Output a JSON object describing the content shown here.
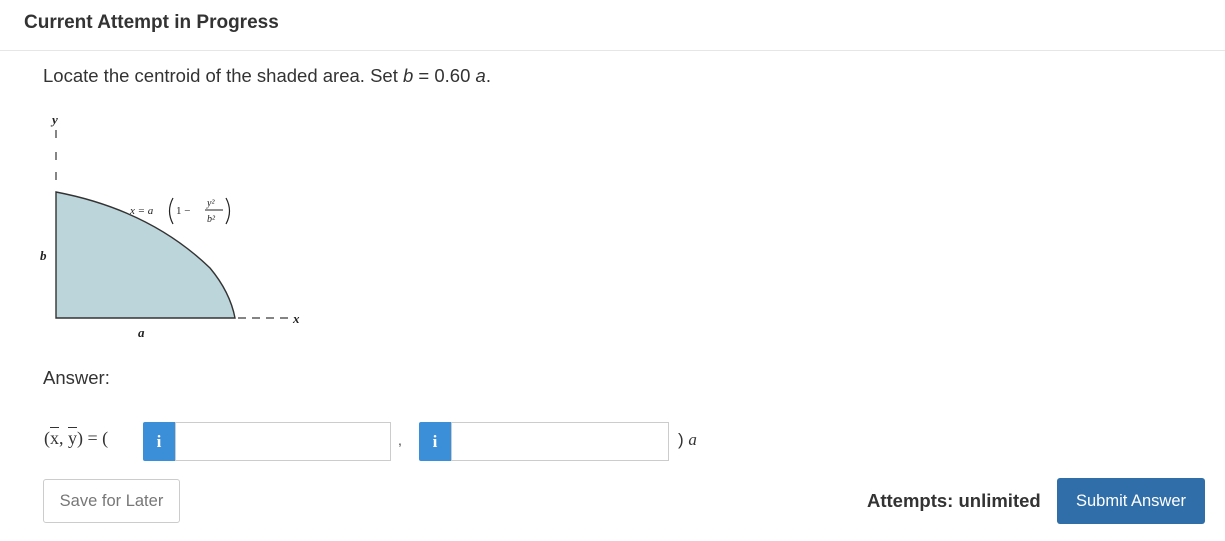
{
  "header": {
    "title": "Current Attempt in Progress"
  },
  "question": {
    "text_prefix": "Locate the centroid of the shaded area. Set ",
    "var_b": "b",
    "equals": " = 0.60 ",
    "var_a": "a",
    "period": "."
  },
  "figure": {
    "y_label": "y",
    "b_label": "b",
    "a_label": "a",
    "x_label": "x",
    "eq_lhs": "x = a",
    "eq_one": "1 −",
    "eq_num": "y²",
    "eq_den": "b²",
    "fill_color": "#bcd5da"
  },
  "answer": {
    "label": "Answer:",
    "xbar": "x",
    "ybar": "y",
    "expr_open": "(",
    "expr_sep": ", ",
    "expr_close": ") = (",
    "info_label": "i",
    "input1_value": "",
    "input2_value": "",
    "comma": ",",
    "close_paren": ") ",
    "unit": "a"
  },
  "footer": {
    "save_label": "Save for Later",
    "attempts_text": "Attempts: unlimited",
    "submit_label": "Submit Answer"
  }
}
